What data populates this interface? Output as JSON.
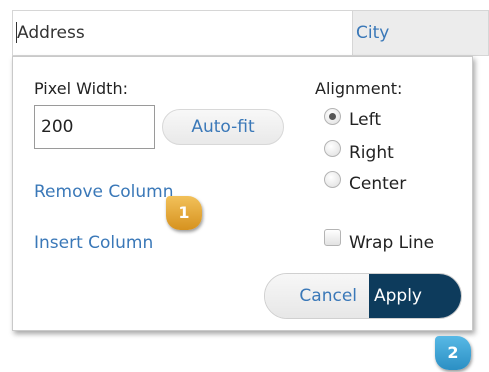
{
  "columns": {
    "active_header": "Address",
    "next_header": "City"
  },
  "pixel_width": {
    "label": "Pixel Width:",
    "value": "200",
    "autofit_label": "Auto-fit"
  },
  "actions": {
    "remove_column": "Remove Column",
    "insert_column": "Insert Column"
  },
  "alignment": {
    "label": "Alignment:",
    "options": [
      {
        "label": "Left",
        "checked": true
      },
      {
        "label": "Right",
        "checked": false
      },
      {
        "label": "Center",
        "checked": false
      }
    ]
  },
  "wrap_line": {
    "label": "Wrap Line",
    "checked": false
  },
  "buttons": {
    "cancel": "Cancel",
    "apply": "Apply"
  },
  "callouts": {
    "first": "1",
    "second": "2"
  },
  "colors": {
    "link": "#3a78b8",
    "apply_bg": "#0d3b5c",
    "badge_1": "#e0a030",
    "badge_2": "#3aa4d8"
  }
}
